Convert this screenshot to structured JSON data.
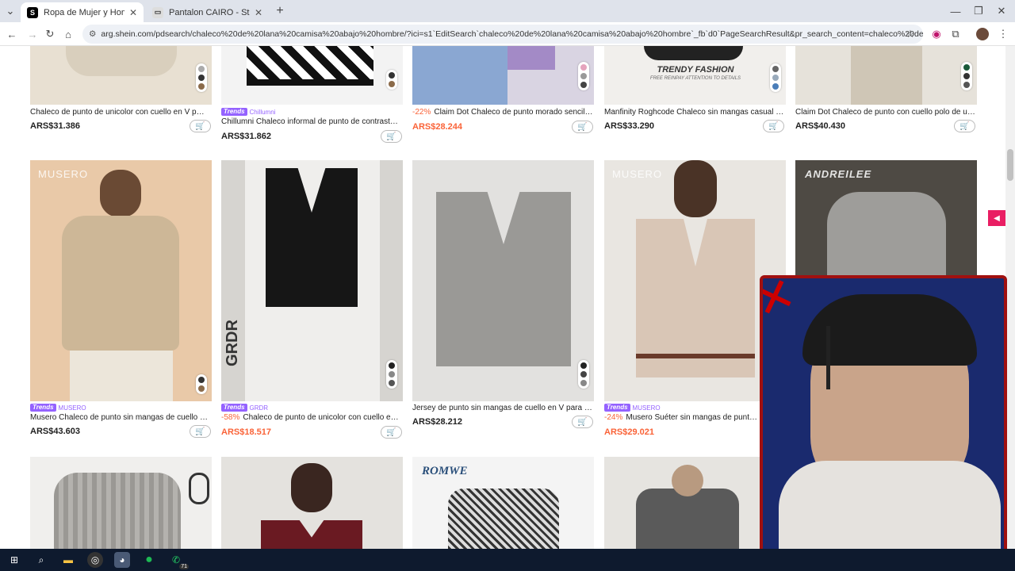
{
  "browser": {
    "tabs": [
      {
        "title": "Ropa de Mujer y Hombre, Com",
        "favicon": "S",
        "active": true
      },
      {
        "title": "Pantalon CAIRO - Stars Hombre",
        "favicon": "S",
        "active": false
      }
    ],
    "new_tab_label": "+",
    "url": "arg.shein.com/pdsearch/chaleco%20de%20lana%20camisa%20abajo%20hombre/?ici=s1`EditSearch`chaleco%20de%20lana%20camisa%20abajo%20hombre`_fb`d0`PageSearchResult&pr_search_content=chaleco%20de%20lana%20camisa%20..."
  },
  "products": {
    "row1": [
      {
        "name": "Chaleco de punto de unicolor con cuello en V para h...",
        "price": "ARS$31.386"
      },
      {
        "trend": "Trends",
        "brand": "Chillumni",
        "name": "Chillumni Chaleco informal de punto de contraste de ...",
        "price": "ARS$31.862"
      },
      {
        "discount": "-22%",
        "name": "Claim Dot Chaleco de punto morado sencillo p...",
        "price": "ARS$28.244"
      },
      {
        "name": "Manfinity Roghcode Chaleco sin mangas casual y vint...",
        "price": "ARS$33.290",
        "img_text": "TRENDY FASHION",
        "img_sub": "FREE REINPAY ATTENTION TO DETAILS"
      },
      {
        "name": "Claim Dot Chaleco de punto con cuello polo de unico...",
        "price": "ARS$40.430"
      }
    ],
    "row2": [
      {
        "trend": "Trends",
        "brand": "MUSERO",
        "name": "Musero Chaleco de punto sin mangas de cuello en V ...",
        "price": "ARS$43.603",
        "img_text": "MUSERO"
      },
      {
        "trend": "Trends",
        "brand": "GRDR",
        "discount": "-58%",
        "name": "Chaleco de punto de unicolor con cuello en V ...",
        "price": "ARS$18.517",
        "img_text": "GRDR"
      },
      {
        "name": "Jersey de punto sin mangas de cuello en V para hom...",
        "price": "ARS$28.212"
      },
      {
        "trend": "Trends",
        "brand": "MUSERO",
        "discount": "-24%",
        "name": "Musero Suéter sin mangas de punto con",
        "price": "ARS$29.021",
        "img_text": "MUSERO"
      },
      {
        "img_text": "ANDREILEE"
      }
    ],
    "row3": [
      {},
      {},
      {
        "img_text": "ROMWE"
      },
      {}
    ]
  },
  "colors": {
    "tabbar": "#dfe3eb",
    "sale": "#fa6338",
    "trends": "#9462ff",
    "webcam_border": "#a01010"
  },
  "taskbar": {
    "icons": [
      "windows-start",
      "search",
      "file-explorer",
      "obs",
      "chrome",
      "spotify",
      "whatsapp"
    ],
    "whatsapp_badge": "71"
  }
}
